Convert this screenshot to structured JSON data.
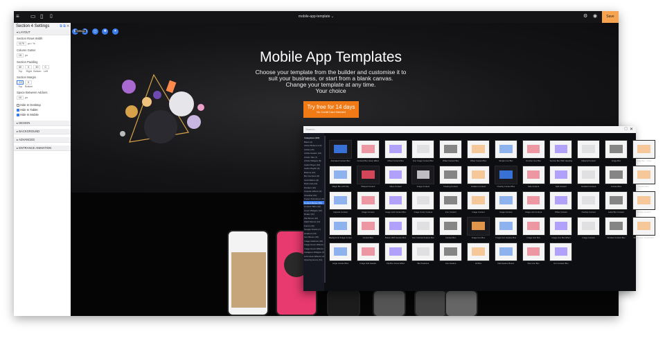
{
  "topbar": {
    "title": "mobile-app-template",
    "title_chevron": "⌄",
    "save_label": "Save",
    "menu_icon": "hamburger-icon",
    "view_icons": [
      "desktop-icon",
      "tablet-icon",
      "mobile-icon"
    ]
  },
  "panel": {
    "title": "Section 4 Settings",
    "layout_label": "LAYOUT",
    "rows_width_label": "Section Rows Width",
    "rows_width_value": "1170",
    "rows_width_unit": "px / %",
    "gutter_label": "Column Gutter",
    "gutter_value": "15",
    "gutter_unit": "px",
    "padding_label": "Section Padding",
    "padding_values": [
      "30",
      "0",
      "30",
      "0"
    ],
    "padding_sides": [
      "Top",
      "Right",
      "Bottom",
      "Left"
    ],
    "margin_label": "Section Margin",
    "margin_values": [
      "-10",
      "0"
    ],
    "margin_sides": [
      "Top",
      "Bottom"
    ],
    "space_label": "Space Between Addons",
    "space_value": "10",
    "space_unit": "px",
    "hide_desktop": "Hide In Desktop",
    "hide_tablet": "Hide In Tablet",
    "hide_mobile": "Hide In Mobile",
    "design_label": "DESIGN",
    "background_label": "BACKGROUND",
    "advanced_label": "ADVANCED",
    "entrance_label": "ENTRANCE ANIMATION"
  },
  "toolbar": {
    "tooltip": "Settings"
  },
  "hero": {
    "title": "Mobile App Templates",
    "subtitle_1": "Choose your template from the builder and customise it to",
    "subtitle_2": "suit your business, or start from a blank canvas.",
    "subtitle_3": "Change your template at any time.",
    "subtitle_4": "Your choice",
    "cta_main": "Try free for 14 days",
    "cta_sub": "No Credit Card Needed"
  },
  "modal": {
    "search_placeholder": "Search...",
    "categories_header": "Categories (423)",
    "categories": [
      "Basic (4)",
      "Action Buttons (12)",
      "Article (15)",
      "Article Header (10)",
      "Article Title (7)",
      "Article Widgets (8)",
      "Audio Player (16)",
      "Audio Playlist (6)",
      "Buttons (16)",
      "Bot Counters (8)",
      "Card Sliders (8)",
      "Dark Lists (11)",
      "Dividers (10)",
      "Capsule Effects (4)",
      "Checklist (10)",
      "Footer Animations (10)",
      "Content Boxes (50)",
      "Content Tabs (14)",
      "Cover Widgets (18)",
      "Dealer (11)",
      "Flip Boxes (10)",
      "Flash Menus (12)",
      "Forms (10)",
      "Google Charts (7)",
      "Headers (10)",
      "Icon Boxes (16)",
      "Image Galleries (10)",
      "Image Hover Effects (10)",
      "Image Hover Effects (12)",
      "Instagram Widgets (3)",
      "Link Hover Effects (12)",
      "Opening Hours (12)"
    ],
    "selected_category": "Content Boxes (50)",
    "tiles": [
      {
        "label": "Animated Content Box",
        "style": "dark"
      },
      {
        "label": "Content Box Hover Effect",
        "style": "light"
      },
      {
        "label": "Offset Content Box",
        "style": "light"
      },
      {
        "label": "Icon Image Content Box",
        "style": "light"
      },
      {
        "label": "Offset Content Box",
        "style": "light"
      },
      {
        "label": "Offset Content Box",
        "style": "light"
      },
      {
        "label": "Simple Icon Box",
        "style": "light"
      },
      {
        "label": "Number Icon Box",
        "style": "light"
      },
      {
        "label": "Service Box With Heading",
        "style": "light"
      },
      {
        "label": "Material Content",
        "style": "light"
      },
      {
        "label": "Image Box",
        "style": "light"
      },
      {
        "label": "Image Box - Links",
        "style": "light"
      },
      {
        "label": "Magic Box with Flip",
        "style": "light"
      },
      {
        "label": "Shaped Content",
        "style": "dark"
      },
      {
        "label": "Video Content",
        "style": "light"
      },
      {
        "label": "Image Content",
        "style": "dark"
      },
      {
        "label": "Floating Content",
        "style": "light"
      },
      {
        "label": "Gradient Content",
        "style": "light"
      },
      {
        "label": "Overlay Content Box",
        "style": "dark"
      },
      {
        "label": "Side Content",
        "style": "light"
      },
      {
        "label": "Split Content",
        "style": "light"
      },
      {
        "label": "Gradient Content",
        "style": "light"
      },
      {
        "label": "Content Box",
        "style": "light"
      },
      {
        "label": "Content Box",
        "style": "light"
      },
      {
        "label": "Capsule Content",
        "style": "light"
      },
      {
        "label": "Image Content",
        "style": "light"
      },
      {
        "label": "Image Grid Content Box",
        "style": "light"
      },
      {
        "label": "Image Cover Content",
        "style": "light"
      },
      {
        "label": "Icon Content",
        "style": "light"
      },
      {
        "label": "Image Content",
        "style": "light"
      },
      {
        "label": "Image Content",
        "style": "light"
      },
      {
        "label": "Image Link Content",
        "style": "light"
      },
      {
        "label": "Offset Content",
        "style": "light"
      },
      {
        "label": "Overlap Content",
        "style": "light"
      },
      {
        "label": "Label Box Content",
        "style": "light"
      },
      {
        "label": "Overlay Content",
        "style": "light"
      },
      {
        "label": "Background Image Content",
        "style": "light"
      },
      {
        "label": "Content Box",
        "style": "light"
      },
      {
        "label": "Button With Section Box",
        "style": "light"
      },
      {
        "label": "Icon Colored Feature Box",
        "style": "light"
      },
      {
        "label": "Content Box",
        "style": "light"
      },
      {
        "label": "Image Icon Box",
        "style": "dark"
      },
      {
        "label": "Image Icon Feature Box",
        "style": "light"
      },
      {
        "label": "Image Icon Box",
        "style": "light"
      },
      {
        "label": "Image Icon Box Effect",
        "style": "light"
      },
      {
        "label": "Image Content",
        "style": "light"
      },
      {
        "label": "Number Content Box",
        "style": "light"
      },
      {
        "label": "Virtual Icon Content Box",
        "style": "light"
      },
      {
        "label": "Large Content Box",
        "style": "light"
      },
      {
        "label": "Image Grid Header",
        "style": "light"
      },
      {
        "label": "Flip Box Hover Effect",
        "style": "light"
      },
      {
        "label": "Box Features",
        "style": "light"
      },
      {
        "label": "Icon Feature",
        "style": "light"
      },
      {
        "label": "Lift Box",
        "style": "light"
      },
      {
        "label": "Flat Feature Boxes",
        "style": "light"
      },
      {
        "label": "Flex Icon Box",
        "style": "light"
      },
      {
        "label": "Icon Content Box",
        "style": "light"
      }
    ]
  },
  "colors": {
    "accent": "#3b7bea",
    "cta": "#f07a16",
    "save": "#f7a34f"
  }
}
